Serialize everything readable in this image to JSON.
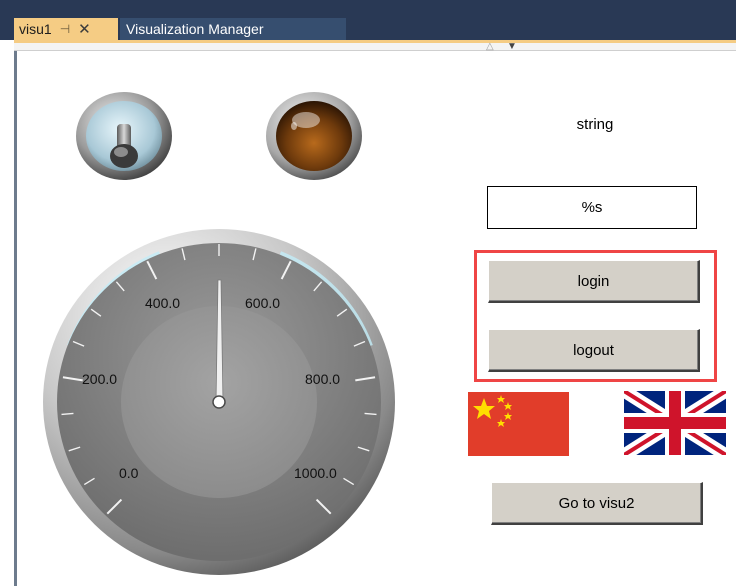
{
  "tabs": {
    "active_label": "visu1",
    "active_pin_icon": "pin-icon",
    "active_close_icon": "close-icon",
    "inactive_label": "Visualization Manager"
  },
  "visu": {
    "string_label": "string",
    "text_field_value": "%s",
    "login_button": "login",
    "logout_button": "logout",
    "goto_button": "Go to visu2",
    "flags": [
      "china-flag-icon",
      "uk-flag-icon"
    ],
    "highlight_color": "#ef4545",
    "gauge": {
      "scale_labels": [
        "0.0",
        "200.0",
        "400.0",
        "600.0",
        "800.0",
        "1000.0"
      ],
      "min": 0,
      "max": 1000,
      "value": 500
    }
  }
}
